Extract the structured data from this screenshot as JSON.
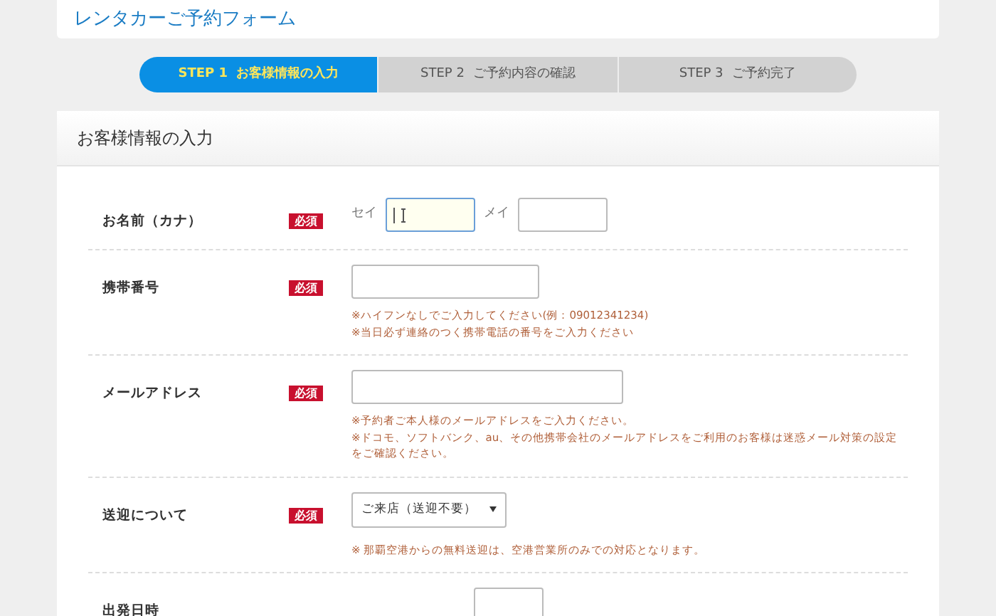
{
  "header": {
    "title": "レンタカーご予約フォーム"
  },
  "steps": [
    {
      "number": "STEP 1",
      "label": "お客様情報の入力",
      "selected": true
    },
    {
      "number": "STEP 2",
      "label": "ご予約内容の確認",
      "selected": false
    },
    {
      "number": "STEP 3",
      "label": "ご予約完了",
      "selected": false
    }
  ],
  "section": {
    "title": "お客様情報の入力"
  },
  "fields": [
    {
      "kind": "name",
      "label": "お名前（カナ）",
      "badge": "必須",
      "parts": [
        {
          "label": "セイ",
          "focused": true
        },
        {
          "label": "メイ",
          "focused": false
        }
      ]
    },
    {
      "kind": "phone",
      "label": "携帯番号",
      "badge": "必須",
      "notes": [
        "※ハイフンなしでご入力してください(例：09012341234)",
        "※当日必ず連絡のつく携帯電話の番号をご入力ください"
      ]
    },
    {
      "kind": "email",
      "label": "メールアドレス",
      "badge": "必須",
      "notes": [
        "※予約者ご本人様のメールアドレスをご入力ください。",
        "※ドコモ、ソフトバンク、au、その他携帯会社のメールアドレスをご利用のお客様は迷惑メール対策の設定をご確認ください。"
      ]
    },
    {
      "kind": "select",
      "label": "送迎について",
      "badge": "必須",
      "value": "ご来店（送迎不要）",
      "notes": [
        "※ 那覇空港からの無料送迎は、空港営業所のみでの対応となります。"
      ]
    },
    {
      "kind": "datetime",
      "label": "出発日時"
    }
  ]
}
